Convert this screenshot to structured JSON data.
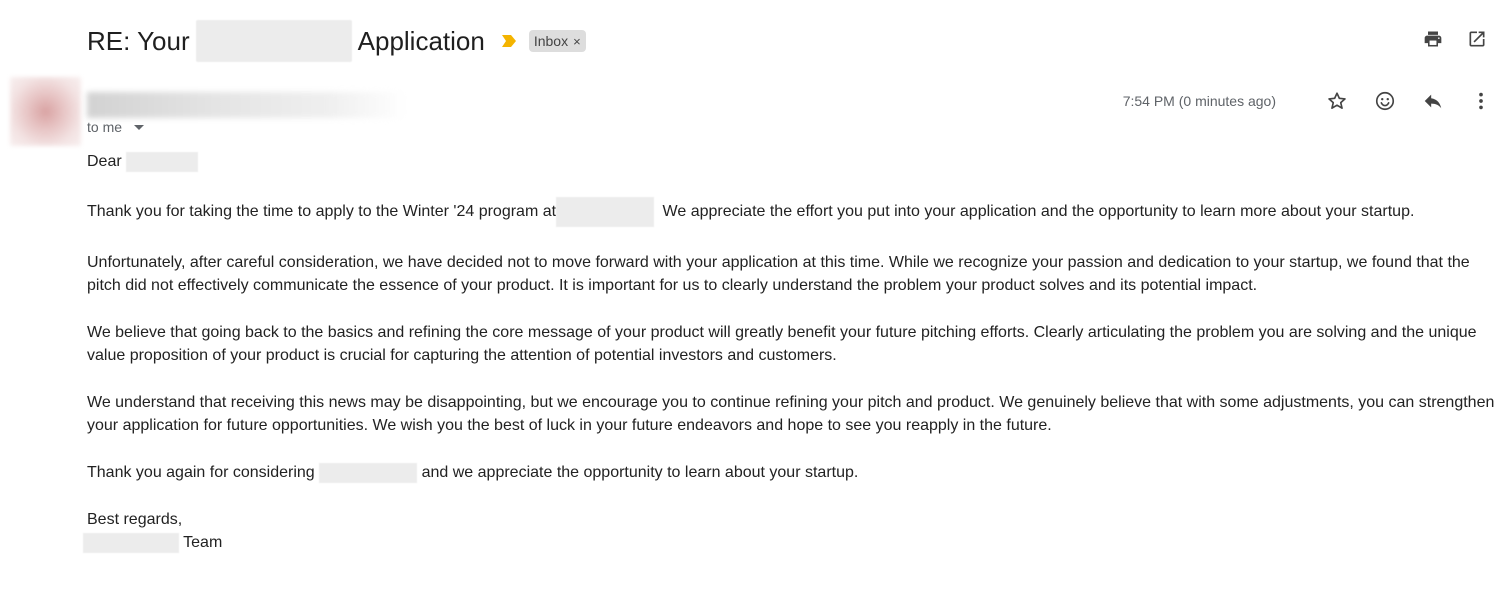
{
  "subject": {
    "prefix": "RE: Your",
    "suffix": "Application",
    "label": "Inbox",
    "label_remove": "×"
  },
  "icons": {
    "important": "important-marker-icon",
    "print": "print-icon",
    "open_new_window": "open-in-new-window-icon",
    "star": "star-icon",
    "emoji": "emoji-icon",
    "reply": "reply-icon",
    "more": "more-vert-icon"
  },
  "colors": {
    "important_marker": "#f4b400",
    "label_chip": "#dddddd",
    "muted_text": "#5f6368"
  },
  "message": {
    "recipients": "to me",
    "timestamp": "7:54 PM (0 minutes ago)",
    "greeting": "Dear",
    "p1_a": "Thank you for taking the time to apply to the Winter '24 program at",
    "p1_b": "We appreciate the effort you put into your application and the opportunity to learn more about your startup.",
    "p2": "Unfortunately, after careful consideration, we have decided not to move forward with your application at this time. While we recognize your passion and dedication to your startup, we found that the pitch did not effectively communicate the essence of your product. It is important for us to clearly understand the problem your product solves and its potential impact.",
    "p3": "We believe that going back to the basics and refining the core message of your product will greatly benefit your future pitching efforts. Clearly articulating the problem you are solving and the unique value proposition of your product is crucial for capturing the attention of potential investors and customers.",
    "p4": "We understand that receiving this news may be disappointing, but we encourage you to continue refining your pitch and product. We genuinely believe that with some adjustments, you can strengthen your application for future opportunities. We wish you the best of luck in your future endeavors and hope to see you reapply in the future.",
    "p5_a": "Thank you again for considering",
    "p5_b": "and we appreciate the opportunity to learn about your startup.",
    "signoff": "Best regards,",
    "team": "Team"
  }
}
